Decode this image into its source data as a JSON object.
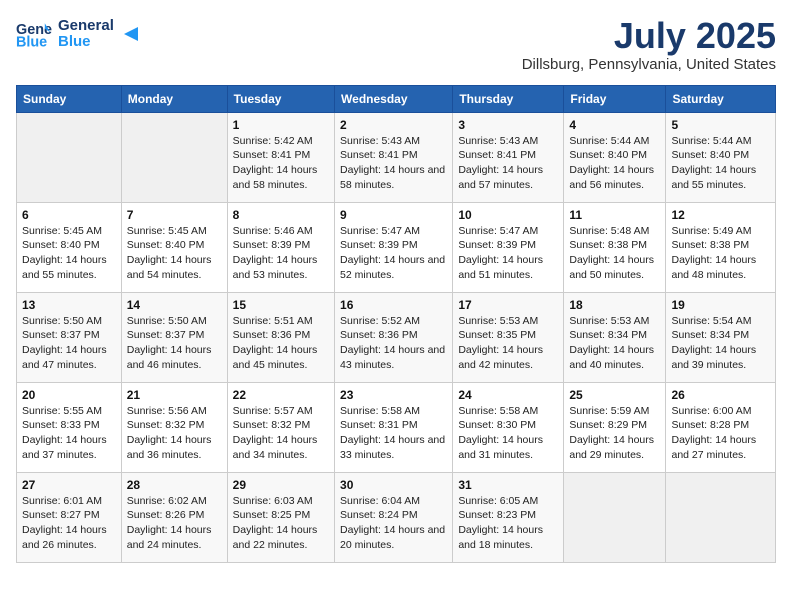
{
  "header": {
    "logo_line1": "General",
    "logo_line2": "Blue",
    "title": "July 2025",
    "subtitle": "Dillsburg, Pennsylvania, United States"
  },
  "days_of_week": [
    "Sunday",
    "Monday",
    "Tuesday",
    "Wednesday",
    "Thursday",
    "Friday",
    "Saturday"
  ],
  "weeks": [
    [
      {
        "day": "",
        "info": ""
      },
      {
        "day": "",
        "info": ""
      },
      {
        "day": "1",
        "sunrise": "5:42 AM",
        "sunset": "8:41 PM",
        "daylight": "14 hours and 58 minutes."
      },
      {
        "day": "2",
        "sunrise": "5:43 AM",
        "sunset": "8:41 PM",
        "daylight": "14 hours and 58 minutes."
      },
      {
        "day": "3",
        "sunrise": "5:43 AM",
        "sunset": "8:41 PM",
        "daylight": "14 hours and 57 minutes."
      },
      {
        "day": "4",
        "sunrise": "5:44 AM",
        "sunset": "8:40 PM",
        "daylight": "14 hours and 56 minutes."
      },
      {
        "day": "5",
        "sunrise": "5:44 AM",
        "sunset": "8:40 PM",
        "daylight": "14 hours and 55 minutes."
      }
    ],
    [
      {
        "day": "6",
        "sunrise": "5:45 AM",
        "sunset": "8:40 PM",
        "daylight": "14 hours and 55 minutes."
      },
      {
        "day": "7",
        "sunrise": "5:45 AM",
        "sunset": "8:40 PM",
        "daylight": "14 hours and 54 minutes."
      },
      {
        "day": "8",
        "sunrise": "5:46 AM",
        "sunset": "8:39 PM",
        "daylight": "14 hours and 53 minutes."
      },
      {
        "day": "9",
        "sunrise": "5:47 AM",
        "sunset": "8:39 PM",
        "daylight": "14 hours and 52 minutes."
      },
      {
        "day": "10",
        "sunrise": "5:47 AM",
        "sunset": "8:39 PM",
        "daylight": "14 hours and 51 minutes."
      },
      {
        "day": "11",
        "sunrise": "5:48 AM",
        "sunset": "8:38 PM",
        "daylight": "14 hours and 50 minutes."
      },
      {
        "day": "12",
        "sunrise": "5:49 AM",
        "sunset": "8:38 PM",
        "daylight": "14 hours and 48 minutes."
      }
    ],
    [
      {
        "day": "13",
        "sunrise": "5:50 AM",
        "sunset": "8:37 PM",
        "daylight": "14 hours and 47 minutes."
      },
      {
        "day": "14",
        "sunrise": "5:50 AM",
        "sunset": "8:37 PM",
        "daylight": "14 hours and 46 minutes."
      },
      {
        "day": "15",
        "sunrise": "5:51 AM",
        "sunset": "8:36 PM",
        "daylight": "14 hours and 45 minutes."
      },
      {
        "day": "16",
        "sunrise": "5:52 AM",
        "sunset": "8:36 PM",
        "daylight": "14 hours and 43 minutes."
      },
      {
        "day": "17",
        "sunrise": "5:53 AM",
        "sunset": "8:35 PM",
        "daylight": "14 hours and 42 minutes."
      },
      {
        "day": "18",
        "sunrise": "5:53 AM",
        "sunset": "8:34 PM",
        "daylight": "14 hours and 40 minutes."
      },
      {
        "day": "19",
        "sunrise": "5:54 AM",
        "sunset": "8:34 PM",
        "daylight": "14 hours and 39 minutes."
      }
    ],
    [
      {
        "day": "20",
        "sunrise": "5:55 AM",
        "sunset": "8:33 PM",
        "daylight": "14 hours and 37 minutes."
      },
      {
        "day": "21",
        "sunrise": "5:56 AM",
        "sunset": "8:32 PM",
        "daylight": "14 hours and 36 minutes."
      },
      {
        "day": "22",
        "sunrise": "5:57 AM",
        "sunset": "8:32 PM",
        "daylight": "14 hours and 34 minutes."
      },
      {
        "day": "23",
        "sunrise": "5:58 AM",
        "sunset": "8:31 PM",
        "daylight": "14 hours and 33 minutes."
      },
      {
        "day": "24",
        "sunrise": "5:58 AM",
        "sunset": "8:30 PM",
        "daylight": "14 hours and 31 minutes."
      },
      {
        "day": "25",
        "sunrise": "5:59 AM",
        "sunset": "8:29 PM",
        "daylight": "14 hours and 29 minutes."
      },
      {
        "day": "26",
        "sunrise": "6:00 AM",
        "sunset": "8:28 PM",
        "daylight": "14 hours and 27 minutes."
      }
    ],
    [
      {
        "day": "27",
        "sunrise": "6:01 AM",
        "sunset": "8:27 PM",
        "daylight": "14 hours and 26 minutes."
      },
      {
        "day": "28",
        "sunrise": "6:02 AM",
        "sunset": "8:26 PM",
        "daylight": "14 hours and 24 minutes."
      },
      {
        "day": "29",
        "sunrise": "6:03 AM",
        "sunset": "8:25 PM",
        "daylight": "14 hours and 22 minutes."
      },
      {
        "day": "30",
        "sunrise": "6:04 AM",
        "sunset": "8:24 PM",
        "daylight": "14 hours and 20 minutes."
      },
      {
        "day": "31",
        "sunrise": "6:05 AM",
        "sunset": "8:23 PM",
        "daylight": "14 hours and 18 minutes."
      },
      {
        "day": "",
        "info": ""
      },
      {
        "day": "",
        "info": ""
      }
    ]
  ],
  "labels": {
    "sunrise_prefix": "Sunrise: ",
    "sunset_prefix": "Sunset: ",
    "daylight_prefix": "Daylight: "
  }
}
